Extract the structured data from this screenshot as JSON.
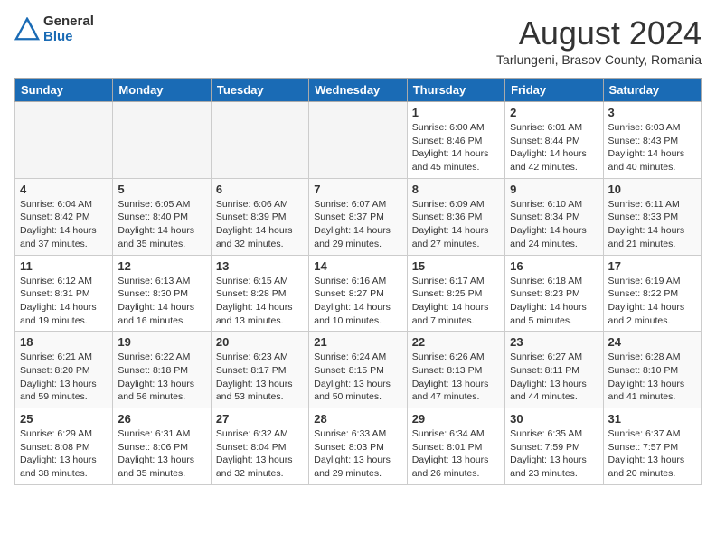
{
  "logo": {
    "general": "General",
    "blue": "Blue"
  },
  "title": {
    "month_year": "August 2024",
    "location": "Tarlungeni, Brasov County, Romania"
  },
  "weekdays": [
    "Sunday",
    "Monday",
    "Tuesday",
    "Wednesday",
    "Thursday",
    "Friday",
    "Saturday"
  ],
  "weeks": [
    [
      {
        "day": "",
        "empty": true
      },
      {
        "day": "",
        "empty": true
      },
      {
        "day": "",
        "empty": true
      },
      {
        "day": "",
        "empty": true
      },
      {
        "day": "1",
        "sunrise": "6:00 AM",
        "sunset": "8:46 PM",
        "daylight": "14 hours and 45 minutes."
      },
      {
        "day": "2",
        "sunrise": "6:01 AM",
        "sunset": "8:44 PM",
        "daylight": "14 hours and 42 minutes."
      },
      {
        "day": "3",
        "sunrise": "6:03 AM",
        "sunset": "8:43 PM",
        "daylight": "14 hours and 40 minutes."
      }
    ],
    [
      {
        "day": "4",
        "sunrise": "6:04 AM",
        "sunset": "8:42 PM",
        "daylight": "14 hours and 37 minutes."
      },
      {
        "day": "5",
        "sunrise": "6:05 AM",
        "sunset": "8:40 PM",
        "daylight": "14 hours and 35 minutes."
      },
      {
        "day": "6",
        "sunrise": "6:06 AM",
        "sunset": "8:39 PM",
        "daylight": "14 hours and 32 minutes."
      },
      {
        "day": "7",
        "sunrise": "6:07 AM",
        "sunset": "8:37 PM",
        "daylight": "14 hours and 29 minutes."
      },
      {
        "day": "8",
        "sunrise": "6:09 AM",
        "sunset": "8:36 PM",
        "daylight": "14 hours and 27 minutes."
      },
      {
        "day": "9",
        "sunrise": "6:10 AM",
        "sunset": "8:34 PM",
        "daylight": "14 hours and 24 minutes."
      },
      {
        "day": "10",
        "sunrise": "6:11 AM",
        "sunset": "8:33 PM",
        "daylight": "14 hours and 21 minutes."
      }
    ],
    [
      {
        "day": "11",
        "sunrise": "6:12 AM",
        "sunset": "8:31 PM",
        "daylight": "14 hours and 19 minutes."
      },
      {
        "day": "12",
        "sunrise": "6:13 AM",
        "sunset": "8:30 PM",
        "daylight": "14 hours and 16 minutes."
      },
      {
        "day": "13",
        "sunrise": "6:15 AM",
        "sunset": "8:28 PM",
        "daylight": "14 hours and 13 minutes."
      },
      {
        "day": "14",
        "sunrise": "6:16 AM",
        "sunset": "8:27 PM",
        "daylight": "14 hours and 10 minutes."
      },
      {
        "day": "15",
        "sunrise": "6:17 AM",
        "sunset": "8:25 PM",
        "daylight": "14 hours and 7 minutes."
      },
      {
        "day": "16",
        "sunrise": "6:18 AM",
        "sunset": "8:23 PM",
        "daylight": "14 hours and 5 minutes."
      },
      {
        "day": "17",
        "sunrise": "6:19 AM",
        "sunset": "8:22 PM",
        "daylight": "14 hours and 2 minutes."
      }
    ],
    [
      {
        "day": "18",
        "sunrise": "6:21 AM",
        "sunset": "8:20 PM",
        "daylight": "13 hours and 59 minutes."
      },
      {
        "day": "19",
        "sunrise": "6:22 AM",
        "sunset": "8:18 PM",
        "daylight": "13 hours and 56 minutes."
      },
      {
        "day": "20",
        "sunrise": "6:23 AM",
        "sunset": "8:17 PM",
        "daylight": "13 hours and 53 minutes."
      },
      {
        "day": "21",
        "sunrise": "6:24 AM",
        "sunset": "8:15 PM",
        "daylight": "13 hours and 50 minutes."
      },
      {
        "day": "22",
        "sunrise": "6:26 AM",
        "sunset": "8:13 PM",
        "daylight": "13 hours and 47 minutes."
      },
      {
        "day": "23",
        "sunrise": "6:27 AM",
        "sunset": "8:11 PM",
        "daylight": "13 hours and 44 minutes."
      },
      {
        "day": "24",
        "sunrise": "6:28 AM",
        "sunset": "8:10 PM",
        "daylight": "13 hours and 41 minutes."
      }
    ],
    [
      {
        "day": "25",
        "sunrise": "6:29 AM",
        "sunset": "8:08 PM",
        "daylight": "13 hours and 38 minutes."
      },
      {
        "day": "26",
        "sunrise": "6:31 AM",
        "sunset": "8:06 PM",
        "daylight": "13 hours and 35 minutes."
      },
      {
        "day": "27",
        "sunrise": "6:32 AM",
        "sunset": "8:04 PM",
        "daylight": "13 hours and 32 minutes."
      },
      {
        "day": "28",
        "sunrise": "6:33 AM",
        "sunset": "8:03 PM",
        "daylight": "13 hours and 29 minutes."
      },
      {
        "day": "29",
        "sunrise": "6:34 AM",
        "sunset": "8:01 PM",
        "daylight": "13 hours and 26 minutes."
      },
      {
        "day": "30",
        "sunrise": "6:35 AM",
        "sunset": "7:59 PM",
        "daylight": "13 hours and 23 minutes."
      },
      {
        "day": "31",
        "sunrise": "6:37 AM",
        "sunset": "7:57 PM",
        "daylight": "13 hours and 20 minutes."
      }
    ]
  ]
}
